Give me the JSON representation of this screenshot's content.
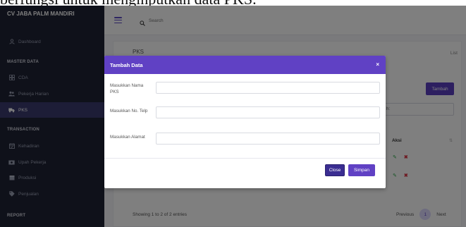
{
  "caption": "berfungsi untuk menginputkan data PKS.",
  "sidebar": {
    "brand": "CV JABA PALM MANDIRI",
    "dashboard": "Dashboard",
    "section_master": "MASTER DATA",
    "master_items": [
      {
        "label": "CDA",
        "icon": "grid-icon"
      },
      {
        "label": "Pekerja Harian",
        "icon": "users-icon"
      },
      {
        "label": "PKS",
        "icon": "truck-icon"
      }
    ],
    "section_transaction": "TRANSACTION",
    "transaction_items": [
      {
        "label": "Kehadiran",
        "icon": "calendar-icon"
      },
      {
        "label": "Upah Pekerja",
        "icon": "money-icon"
      },
      {
        "label": "Produksi",
        "icon": "box-icon"
      },
      {
        "label": "Penjualan",
        "icon": "tag-icon"
      }
    ],
    "section_report": "REPORT",
    "active": "PKS"
  },
  "topbar": {
    "search_placeholder": "Search"
  },
  "page": {
    "title": "PKS",
    "breadcrumb": "List",
    "tambah_label": "Tambah",
    "search_label": "h:",
    "column_aksi": "Aksi",
    "showing": "Showing 1 to 2 of 2 entries",
    "pagination": {
      "previous": "Previous",
      "current": "1",
      "next": "Next"
    },
    "rows": 2
  },
  "modal": {
    "title": "Tambah Data",
    "close_icon": "×",
    "fields": [
      {
        "label": "Masukkan Nama PKS",
        "value": ""
      },
      {
        "label": "Masukkan No. Telp",
        "value": ""
      },
      {
        "label": "Masukkan Alamat",
        "value": ""
      }
    ],
    "close_button": "Close",
    "save_button": "Simpan"
  },
  "colors": {
    "sidebar": "#1f2235",
    "accent": "#6041c4",
    "close_button": "#3a2d91"
  }
}
